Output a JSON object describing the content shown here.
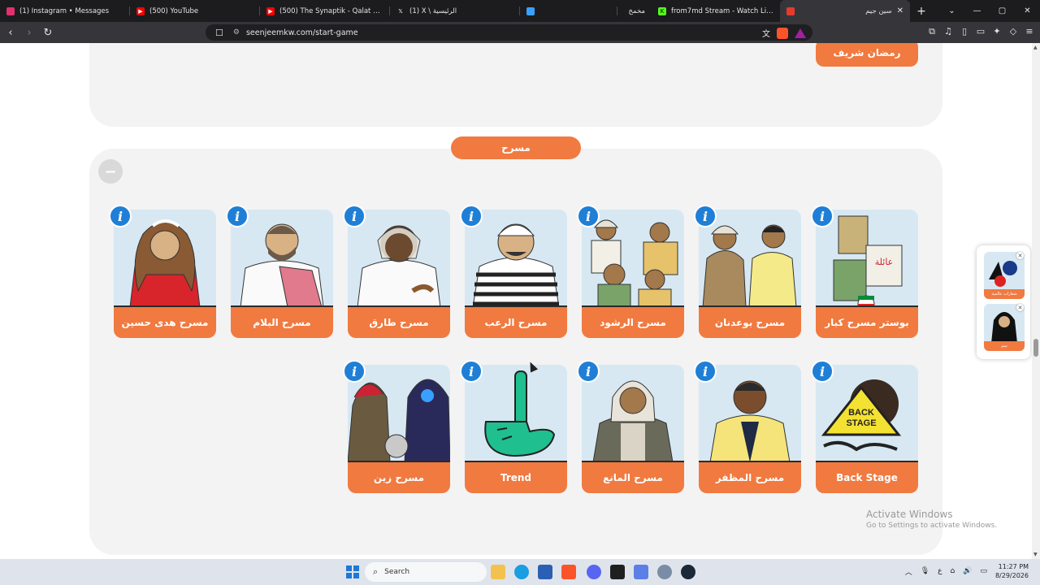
{
  "browser": {
    "tabs": [
      {
        "title": "(1) Instagram • Messages",
        "icon": "instagram-icon",
        "color": "#e1306c"
      },
      {
        "title": "(500) YouTube",
        "icon": "youtube-icon",
        "color": "#ff0000"
      },
      {
        "title": "(500) The Synaptik - Qalat Lee (Lyric",
        "icon": "youtube-icon",
        "color": "#ff0000"
      },
      {
        "title": "(1) X \\ الرئيسية",
        "icon": "x-icon",
        "color": "#ffffff"
      },
      {
        "title": "",
        "icon": "app-icon",
        "color": "#3aa0ff"
      },
      {
        "title": "مخمخ",
        "icon": "app-icon",
        "color": "#666666"
      },
      {
        "title": "from7md Stream - Watch Live on Ki",
        "icon": "kick-icon",
        "color": "#53fc18"
      },
      {
        "title": "سين جيم",
        "icon": "seenjeem-icon",
        "color": "#e63a2e",
        "active": true
      }
    ],
    "url": "seenjeemkw.com/start-game",
    "new_tab": "+",
    "win_min": "—",
    "win_max": "▢",
    "win_close": "✕"
  },
  "page": {
    "prev_section_button": "رمضان شريف",
    "section_title": "مسرح",
    "collapse_symbol": "−",
    "info_glyph": "i",
    "categories_row1": [
      {
        "label": "بوستر مسرح كبار"
      },
      {
        "label": "مسرح بوعدنان"
      },
      {
        "label": "مسرح الرشود"
      },
      {
        "label": "مسرح الرعب"
      },
      {
        "label": "مسرح طارق"
      },
      {
        "label": "مسرح البلام"
      },
      {
        "label": "مسرح هدى حسين"
      }
    ],
    "categories_row2": [
      {
        "label": "Back Stage"
      },
      {
        "label": "مسرح المظفر"
      },
      {
        "label": "مسرح المانع"
      },
      {
        "label": "Trend"
      },
      {
        "label": "مسرح زين"
      }
    ],
    "side_widget": {
      "items": [
        {
          "caption": "شعارات عالمية"
        },
        {
          "caption": "ميم"
        }
      ]
    },
    "watermark": {
      "line1": "Activate Windows",
      "line2": "Go to Settings to activate Windows."
    }
  },
  "taskbar": {
    "search_placeholder": "Search",
    "time": "11:27 PM",
    "date": "8/29/2026",
    "lang": "ع"
  },
  "colors": {
    "accent_orange": "#f07a40",
    "info_blue": "#1f7fd6",
    "card_bg": "#d7e8f3",
    "panel_bg": "#f3f3f3"
  }
}
